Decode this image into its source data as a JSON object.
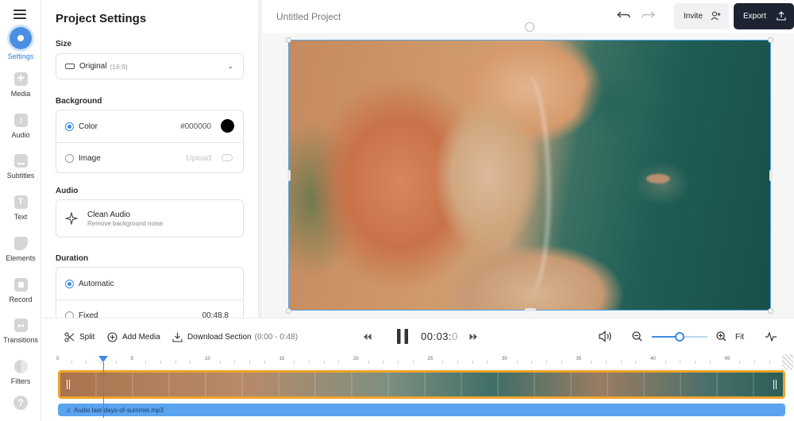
{
  "rail": {
    "items": [
      {
        "label": "Settings",
        "icon": "settings-icon"
      },
      {
        "label": "Media",
        "icon": "media-icon"
      },
      {
        "label": "Audio",
        "icon": "audio-icon"
      },
      {
        "label": "Subtitles",
        "icon": "subtitles-icon"
      },
      {
        "label": "Text",
        "icon": "text-icon"
      },
      {
        "label": "Elements",
        "icon": "elements-icon"
      },
      {
        "label": "Record",
        "icon": "record-icon"
      },
      {
        "label": "Transitions",
        "icon": "transitions-icon"
      },
      {
        "label": "Filters",
        "icon": "filters-icon"
      }
    ]
  },
  "panel": {
    "title": "Project Settings",
    "size": {
      "label": "Size",
      "value": "Original",
      "ratio": "(16:9)"
    },
    "background": {
      "label": "Background",
      "color_label": "Color",
      "color_value": "#000000",
      "image_label": "Image",
      "upload_label": "Upload"
    },
    "audio": {
      "label": "Audio",
      "clean_title": "Clean Audio",
      "clean_sub": "Remove background noise"
    },
    "duration": {
      "label": "Duration",
      "automatic_label": "Automatic",
      "fixed_label": "Fixed",
      "fixed_value": "00:48.8"
    }
  },
  "topbar": {
    "project_name": "Untitled Project",
    "invite_label": "Invite",
    "export_label": "Export"
  },
  "controls": {
    "split_label": "Split",
    "add_media_label": "Add Media",
    "download_label": "Download Section",
    "download_range": "(0:00 - 0:48)",
    "time_main": "00:03:",
    "time_last": "0",
    "fit_label": "Fit",
    "zoom_level": 0.5
  },
  "timeline": {
    "ticks": [
      "0",
      "5",
      "10",
      "15",
      "20",
      "25",
      "30",
      "35",
      "40",
      "45"
    ],
    "audio_label": "Audio last-days-of-summer.mp3"
  },
  "colors": {
    "accent": "#3d8be3",
    "export_bg": "#1d2330",
    "clip_border": "#f0a42a",
    "audio_track": "#5aa3ef"
  }
}
